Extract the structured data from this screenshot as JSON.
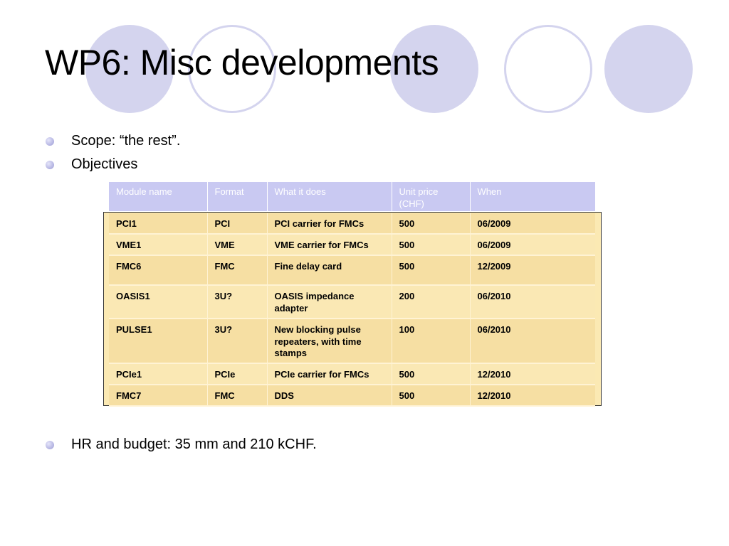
{
  "slide": {
    "title": "WP6: Misc developments",
    "bullets": [
      {
        "text": "Scope: “the rest”."
      },
      {
        "text": "Objectives"
      }
    ],
    "footer_bullet": {
      "text": "HR and budget: 35 mm and 210 kCHF."
    }
  },
  "table": {
    "headers": [
      "Module name",
      "Format",
      "What it does",
      "Unit price (CHF)",
      "When"
    ],
    "rows": [
      [
        "PCI1",
        "PCI",
        "PCI carrier for FMCs",
        "500",
        "06/2009"
      ],
      [
        "VME1",
        "VME",
        "VME carrier for FMCs",
        "500",
        "06/2009"
      ],
      [
        "FMC6",
        "FMC",
        "Fine delay card",
        "500",
        "12/2009"
      ],
      [
        "OASIS1",
        "3U?",
        "OASIS impedance adapter",
        "200",
        "06/2010"
      ],
      [
        "PULSE1",
        "3U?",
        "New blocking pulse repeaters, with time stamps",
        "100",
        "06/2010"
      ],
      [
        "PCIe1",
        "PCIe",
        "PCIe carrier for FMCs",
        "500",
        "12/2010"
      ],
      [
        "FMC7",
        "FMC",
        "DDS",
        "500",
        "12/2010"
      ]
    ]
  },
  "colors": {
    "circle": "#d4d4ee",
    "header_bg": "#c9c9f2",
    "row_bg": "#f6dfa3"
  }
}
